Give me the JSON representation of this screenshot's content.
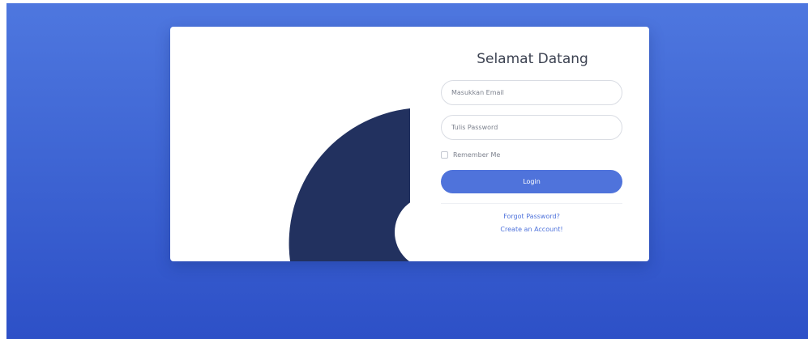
{
  "login": {
    "title": "Selamat Datang",
    "email_placeholder": "Masukkan Email",
    "password_placeholder": "Tulis Password",
    "remember_label": "Remember Me",
    "remember_checked": false,
    "login_label": "Login",
    "forgot_password_label": "Forgot Password?",
    "create_account_label": "Create an Account!"
  },
  "colors": {
    "background_top": "#4e77df",
    "background_bottom": "#2d50c7",
    "card": "#ffffff",
    "illustration_shape": "#22315f",
    "primary_button": "#4f73db",
    "title_text": "#3c4251"
  }
}
